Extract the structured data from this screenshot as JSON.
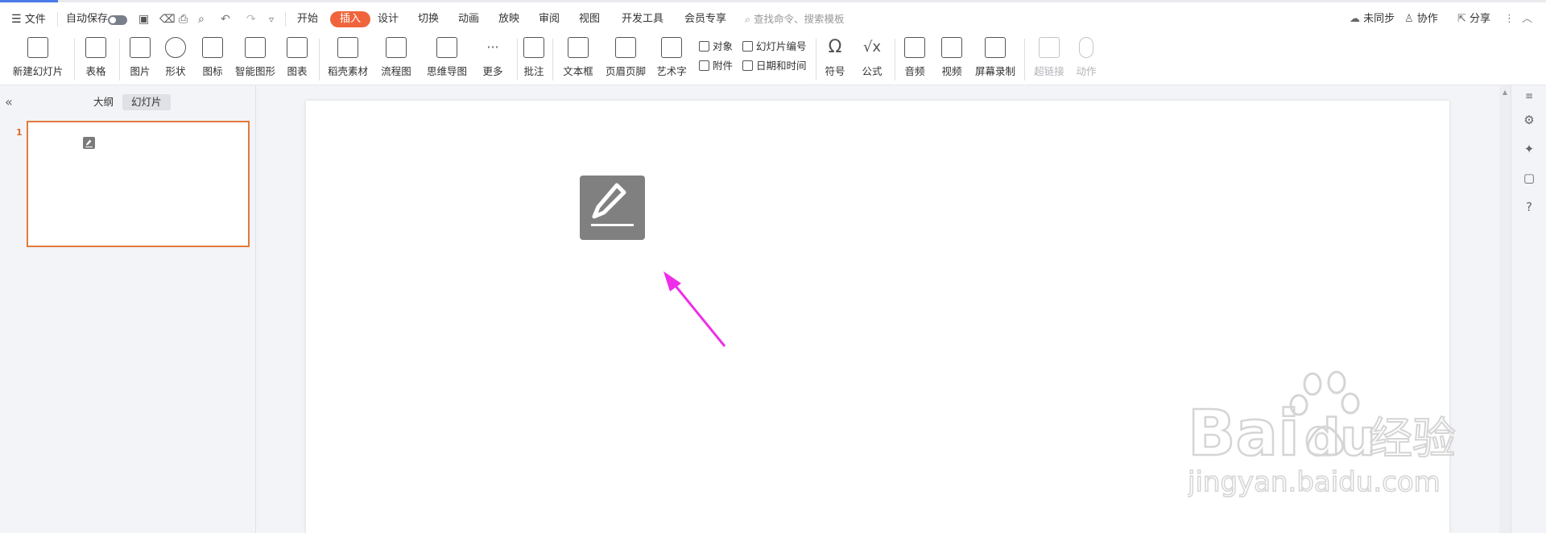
{
  "topbar": {
    "menu_label": "文件",
    "autosave_label": "自动保存",
    "tabs": [
      "开始",
      "插入",
      "设计",
      "切换",
      "动画",
      "放映",
      "审阅",
      "视图",
      "开发工具",
      "会员专享"
    ],
    "active_tab": "插入",
    "search_placeholder": "查找命令、搜索模板",
    "sync_label": "未同步",
    "collab_label": "协作",
    "share_label": "分享"
  },
  "ribbon": {
    "new_slide": "新建幻灯片",
    "table": "表格",
    "picture": "图片",
    "shape": "形状",
    "icon": "图标",
    "smart_art": "智能图形",
    "chart": "图表",
    "material": "稻壳素材",
    "flowchart": "流程图",
    "mindmap": "思维导图",
    "more": "更多",
    "comment": "批注",
    "textbox": "文本框",
    "header_footer": "页眉页脚",
    "wordart": "艺术字",
    "object": "对象",
    "attachment": "附件",
    "slide_number": "幻灯片编号",
    "datetime": "日期和时间",
    "symbol": "符号",
    "formula": "公式",
    "audio": "音频",
    "video": "视频",
    "screen_record": "屏幕录制",
    "hyperlink": "超链接",
    "action": "动作"
  },
  "left_panel": {
    "tab_outline": "大纲",
    "tab_slides": "幻灯片",
    "slide_number": "1"
  },
  "watermark": {
    "brand_left": "Bai",
    "brand_right": "du",
    "brand_cn": "经验",
    "url": "jingyan.baidu.com"
  },
  "colors": {
    "active_tab": "#f0643c",
    "thumb_border": "#e07a3a",
    "arrow": "#ee2ee8",
    "placeholder_icon": "#808080"
  }
}
